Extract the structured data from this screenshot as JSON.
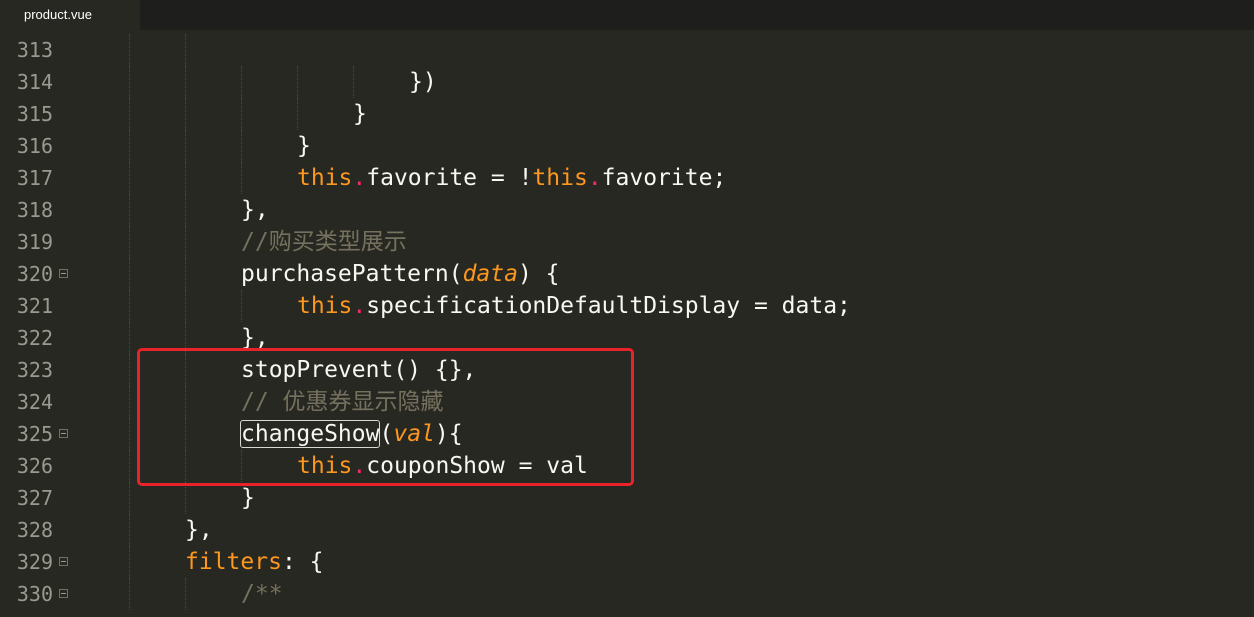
{
  "tab": {
    "label": "product.vue"
  },
  "lines": [
    {
      "num": "313",
      "indent": 2,
      "fold": false,
      "tokens": []
    },
    {
      "num": "314",
      "indent": 6,
      "fold": false,
      "tokens": [
        {
          "t": "plain",
          "v": "})"
        }
      ]
    },
    {
      "num": "315",
      "indent": 5,
      "fold": false,
      "tokens": [
        {
          "t": "plain",
          "v": "}"
        }
      ]
    },
    {
      "num": "316",
      "indent": 4,
      "fold": false,
      "tokens": [
        {
          "t": "plain",
          "v": "}"
        }
      ]
    },
    {
      "num": "317",
      "indent": 4,
      "fold": false,
      "tokens": [
        {
          "t": "kw",
          "v": "this"
        },
        {
          "t": "dot",
          "v": "."
        },
        {
          "t": "plain",
          "v": "favorite = !"
        },
        {
          "t": "kw",
          "v": "this"
        },
        {
          "t": "dot",
          "v": "."
        },
        {
          "t": "plain",
          "v": "favorite;"
        }
      ]
    },
    {
      "num": "318",
      "indent": 3,
      "fold": false,
      "tokens": [
        {
          "t": "plain",
          "v": "},"
        }
      ]
    },
    {
      "num": "319",
      "indent": 3,
      "fold": false,
      "tokens": [
        {
          "t": "cm",
          "v": "//购买类型展示"
        }
      ]
    },
    {
      "num": "320",
      "indent": 3,
      "fold": true,
      "tokens": [
        {
          "t": "plain",
          "v": "purchasePattern("
        },
        {
          "t": "pm",
          "v": "data"
        },
        {
          "t": "plain",
          "v": ") {"
        }
      ]
    },
    {
      "num": "321",
      "indent": 4,
      "fold": false,
      "tokens": [
        {
          "t": "kw",
          "v": "this"
        },
        {
          "t": "dot",
          "v": "."
        },
        {
          "t": "plain",
          "v": "specificationDefaultDisplay = data;"
        }
      ]
    },
    {
      "num": "322",
      "indent": 3,
      "fold": false,
      "tokens": [
        {
          "t": "plain",
          "v": "},"
        }
      ]
    },
    {
      "num": "323",
      "indent": 3,
      "fold": false,
      "tokens": [
        {
          "t": "plain",
          "v": "stopPrevent() {},"
        }
      ]
    },
    {
      "num": "324",
      "indent": 3,
      "fold": false,
      "tokens": [
        {
          "t": "cm",
          "v": "// 优惠券显示隐藏"
        }
      ]
    },
    {
      "num": "325",
      "indent": 3,
      "fold": true,
      "tokens": [
        {
          "t": "box",
          "v": "changeShow"
        },
        {
          "t": "plain",
          "v": "("
        },
        {
          "t": "pm",
          "v": "val"
        },
        {
          "t": "plain",
          "v": "){"
        }
      ]
    },
    {
      "num": "326",
      "indent": 4,
      "fold": false,
      "tokens": [
        {
          "t": "kw",
          "v": "this"
        },
        {
          "t": "dot",
          "v": "."
        },
        {
          "t": "plain",
          "v": "couponShow = val"
        }
      ]
    },
    {
      "num": "327",
      "indent": 3,
      "fold": false,
      "tokens": [
        {
          "t": "plain",
          "v": "}"
        }
      ]
    },
    {
      "num": "328",
      "indent": 2,
      "fold": false,
      "tokens": [
        {
          "t": "plain",
          "v": "},"
        }
      ]
    },
    {
      "num": "329",
      "indent": 2,
      "fold": true,
      "tokens": [
        {
          "t": "kw",
          "v": "filters"
        },
        {
          "t": "plain",
          "v": ": {"
        }
      ]
    },
    {
      "num": "330",
      "indent": 3,
      "fold": true,
      "tokens": [
        {
          "t": "cm",
          "v": "/**"
        }
      ]
    }
  ],
  "colors": {
    "background": "#272822",
    "keyword": "#fd971f",
    "dot": "#f92672",
    "comment": "#75715e",
    "annotation_box": "#e8232b"
  }
}
